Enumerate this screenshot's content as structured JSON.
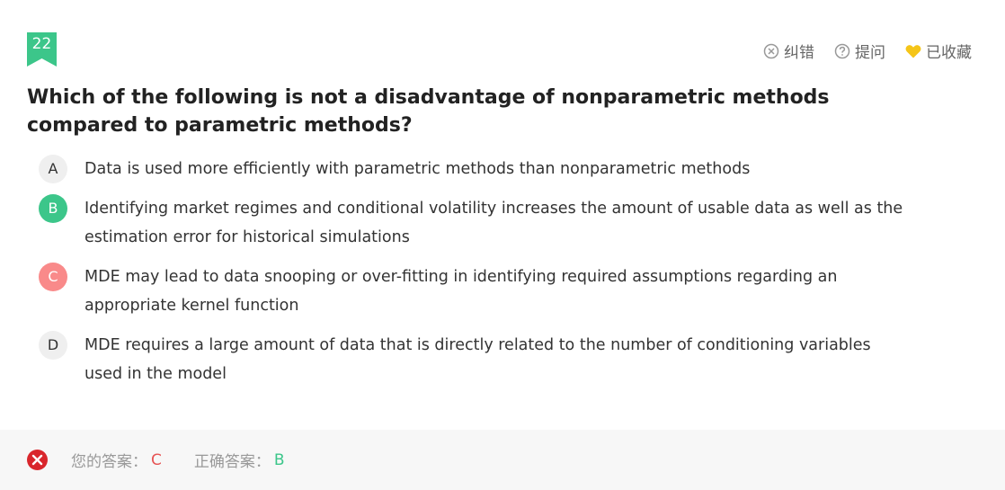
{
  "question": {
    "number": "22",
    "text": "Which of the following is not a disadvantage of nonparametric methods compared to parametric methods?"
  },
  "toolbar": {
    "report_label": "纠错",
    "ask_label": "提问",
    "favorite_label": "已收藏"
  },
  "options": [
    {
      "letter": "A",
      "text": "Data is used more efficiently with parametric methods than nonparametric methods",
      "state": "normal"
    },
    {
      "letter": "B",
      "text": "Identifying market regimes and conditional volatility increases the amount of usable data as well as the estimation error for historical simulations",
      "state": "correct"
    },
    {
      "letter": "C",
      "text": "MDE may lead to data snooping or over-fitting in identifying required assumptions regarding an appropriate kernel function",
      "state": "wrong"
    },
    {
      "letter": "D",
      "text": "MDE requires a large amount of data that is directly related to the number of conditioning variables used in the model",
      "state": "normal"
    }
  ],
  "result": {
    "your_answer_label": "您的答案：",
    "your_answer": "C",
    "correct_answer_label": "正确答案：",
    "correct_answer": "B"
  },
  "colors": {
    "accent_green": "#3cc68a",
    "wrong_red": "#f98a8a",
    "error_red": "#d9262c",
    "favorite_yellow": "#f5c518"
  }
}
